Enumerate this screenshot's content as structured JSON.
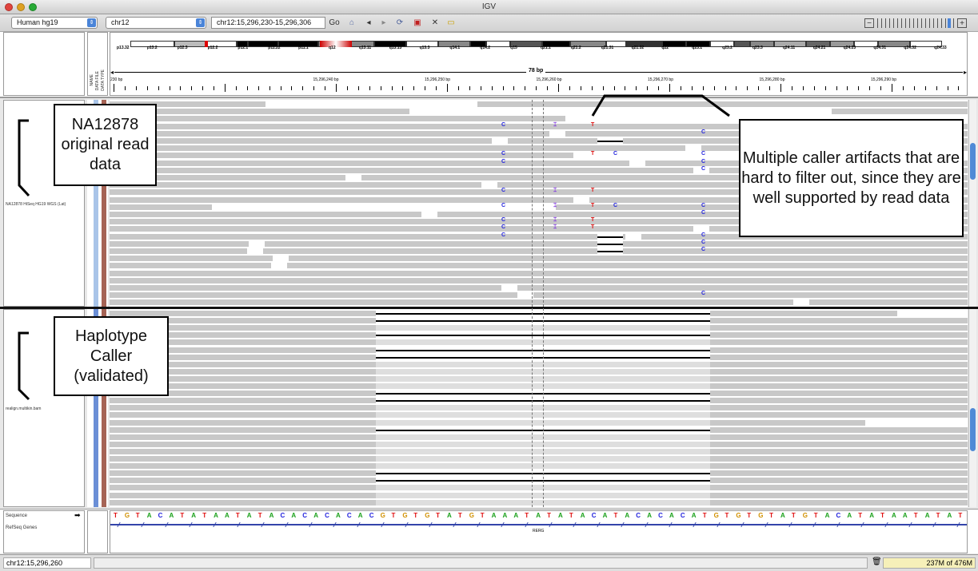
{
  "window": {
    "title": "IGV"
  },
  "toolbar": {
    "genome": "Human hg19",
    "chromosome": "chr12",
    "locus": "chr12:15,296,230-15,296,306",
    "go_label": "Go"
  },
  "ideogram": {
    "bands": [
      "p13.32",
      "p13.2",
      "p12.3",
      "p12.2",
      "p12.1",
      "p11.22",
      "p11.1",
      "q12",
      "q13.11",
      "q13.13",
      "q13.3",
      "q14.1",
      "q14.2",
      "q15",
      "q21.1",
      "q21.2",
      "q21.31",
      "q21.32",
      "q22",
      "q23.1",
      "q23.2",
      "q23.3",
      "q24.11",
      "q24.21",
      "q24.23",
      "q24.31",
      "q24.32",
      "q24.33"
    ],
    "span_label": "78 bp",
    "ruler": [
      "230 bp",
      "15,296,240 bp",
      "15,296,250 bp",
      "15,296,260 bp",
      "15,296,270 bp",
      "15,296,280 bp",
      "15,296,290 bp",
      "15,296,300 bp"
    ],
    "attr_headers": [
      "NAME",
      "DATA FILE",
      "DATA TYPE"
    ]
  },
  "panel1": {
    "track_name": "NA12878 HiSeq HG19 WGS (Lat)",
    "annotation": "NA12878 original read data",
    "callout": "Multiple caller artifacts that are hard to filter out, since they are well supported by read data"
  },
  "panel2": {
    "track_name": "realign.multikin.bam",
    "annotation": "Haplotype Caller (validated)"
  },
  "bottom": {
    "sequence_label": "Sequence",
    "refseq_label": "RefSeq Genes",
    "gene": "RERG",
    "sequence": "TGTACATATAATATACACACACACGTGTGTATGTAAATATATACATACACACATGTGTGTATGTACATATAATATAT"
  },
  "status": {
    "position": "chr12:15,296,260",
    "memory": "237M of 476M"
  },
  "colors": {
    "read": "#c8c8c8",
    "A": "#1aa11a",
    "C": "#2222dd",
    "G": "#d19000",
    "T": "#e01010",
    "insertion": "#7a2be0"
  },
  "mismatches": [
    {
      "row": 3,
      "base": "C",
      "col": "C"
    },
    {
      "row": 3,
      "base": "I",
      "col": "I"
    },
    {
      "row": 3,
      "base": "T",
      "col": "T"
    },
    {
      "row": 4,
      "base": "C",
      "col": "C2"
    },
    {
      "row": 7,
      "base": "C",
      "col": "C"
    },
    {
      "row": 7,
      "base": "T",
      "col": "T"
    },
    {
      "row": 7,
      "base": "C",
      "col": "C1"
    },
    {
      "row": 7,
      "base": "C",
      "col": "C2"
    },
    {
      "row": 8,
      "base": "C",
      "col": "C"
    },
    {
      "row": 8,
      "base": "C",
      "col": "C2"
    },
    {
      "row": 9,
      "base": "C",
      "col": "C2"
    },
    {
      "row": 12,
      "base": "C",
      "col": "C"
    },
    {
      "row": 12,
      "base": "I",
      "col": "I"
    },
    {
      "row": 12,
      "base": "T",
      "col": "T"
    },
    {
      "row": 14,
      "base": "C",
      "col": "C"
    },
    {
      "row": 14,
      "base": "I",
      "col": "I"
    },
    {
      "row": 14,
      "base": "T",
      "col": "T"
    },
    {
      "row": 14,
      "base": "C",
      "col": "C1"
    },
    {
      "row": 14,
      "base": "C",
      "col": "C2"
    },
    {
      "row": 15,
      "base": "C",
      "col": "C2"
    },
    {
      "row": 16,
      "base": "C",
      "col": "C"
    },
    {
      "row": 16,
      "base": "I",
      "col": "I"
    },
    {
      "row": 16,
      "base": "T",
      "col": "T"
    },
    {
      "row": 17,
      "base": "C",
      "col": "C"
    },
    {
      "row": 17,
      "base": "I",
      "col": "I"
    },
    {
      "row": 17,
      "base": "T",
      "col": "T"
    },
    {
      "row": 18,
      "base": "C",
      "col": "C"
    },
    {
      "row": 18,
      "base": "C",
      "col": "C2"
    },
    {
      "row": 19,
      "base": "C",
      "col": "C2"
    },
    {
      "row": 20,
      "base": "C",
      "col": "C2"
    },
    {
      "row": 26,
      "base": "C",
      "col": "C2"
    }
  ]
}
